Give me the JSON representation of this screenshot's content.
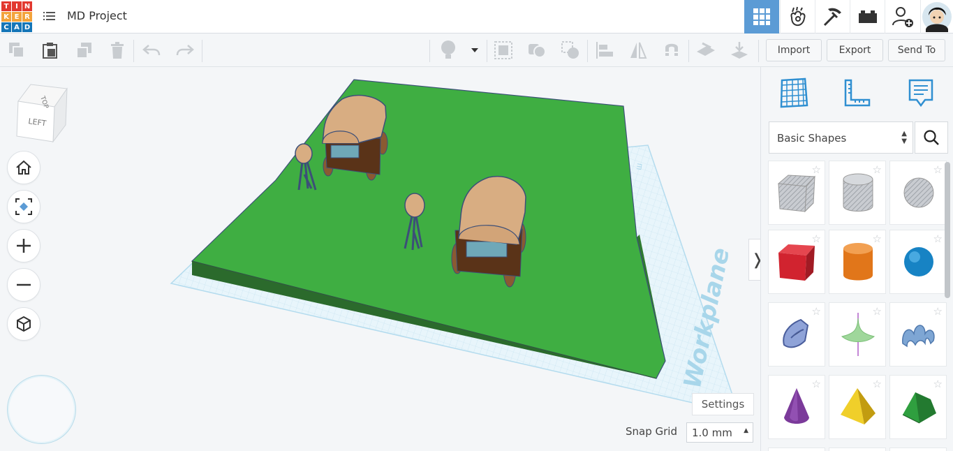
{
  "app": {
    "logo_letters": [
      "T",
      "I",
      "N",
      "K",
      "E",
      "R",
      "C",
      "A",
      "D"
    ],
    "logo_colors": [
      "#e2382f",
      "#e2382f",
      "#e2382f",
      "#f3a33b",
      "#f3a33b",
      "#f3a33b",
      "#1576b8",
      "#1576b8",
      "#1576b8"
    ],
    "project_title": "MD Project",
    "menu_icon": "list-icon"
  },
  "topbar": {
    "icons": [
      "grid-3d-icon",
      "play-hand-icon",
      "pickaxe-icon",
      "brick-icon",
      "add-user-icon",
      "avatar-icon"
    ],
    "active_color": "#5b9bd5"
  },
  "toolbar": {
    "import_label": "Import",
    "export_label": "Export",
    "sendto_label": "Send To",
    "icons": [
      "copy-icon",
      "paste-icon",
      "duplicate-icon",
      "delete-icon",
      "undo-icon",
      "redo-icon",
      "light-icon",
      "dropdown-icon",
      "group-icon",
      "ungroup-icon",
      "hole-icon",
      "align-icon",
      "mirror-icon",
      "magnet-icon",
      "workplane-icon",
      "drop-icon"
    ]
  },
  "viewcube": {
    "face_left": "LEFT",
    "face_top": "TOP"
  },
  "view_controls": [
    "home-icon",
    "fit-icon",
    "zoom-in-icon",
    "zoom-out-icon",
    "ortho-icon"
  ],
  "scene": {
    "workplane_label": "Workplane",
    "ground_color": "#3fae42",
    "grid_color": "#b8dff0"
  },
  "bottom": {
    "settings_label": "Settings",
    "snap_label": "Snap Grid",
    "snap_value": "1.0 mm"
  },
  "panel": {
    "tabs": [
      "workplane-grid-icon",
      "ruler-icon",
      "notes-icon"
    ],
    "category": "Basic Shapes",
    "search_icon": "search-icon",
    "shapes": [
      {
        "name": "box-hole",
        "color": "#b8bcc2"
      },
      {
        "name": "cylinder-hole",
        "color": "#b8bcc2"
      },
      {
        "name": "sphere-hole",
        "color": "#b8bcc2"
      },
      {
        "name": "box",
        "color": "#d1232f"
      },
      {
        "name": "cylinder",
        "color": "#e1761a"
      },
      {
        "name": "sphere",
        "color": "#1783c4"
      },
      {
        "name": "scribble",
        "color": "#7b8fc8"
      },
      {
        "name": "paraboloid",
        "color": "#9fd79b"
      },
      {
        "name": "text",
        "color": "#7ea6d4"
      },
      {
        "name": "cone",
        "color": "#7b3a9a"
      },
      {
        "name": "pyramid",
        "color": "#ecc522"
      },
      {
        "name": "roof",
        "color": "#2f9f3f"
      }
    ]
  }
}
